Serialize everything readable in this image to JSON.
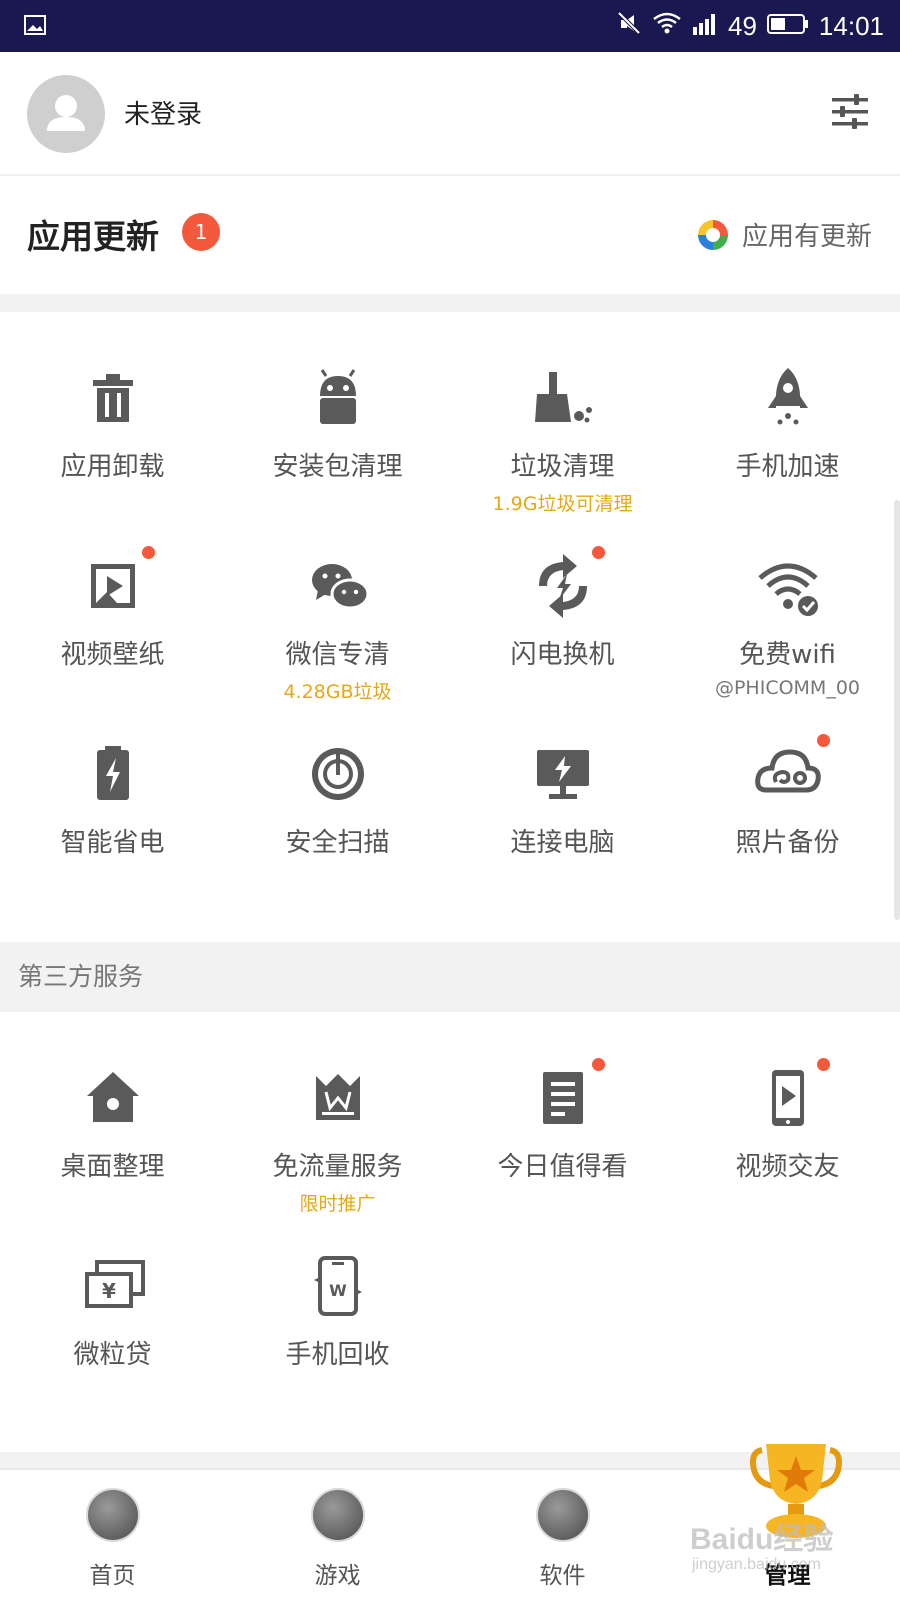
{
  "status_bar": {
    "signal_level": "49",
    "time": "14:01",
    "battery_level": 0.45
  },
  "account": {
    "name": "未登录"
  },
  "updates": {
    "title": "应用更新",
    "badge_count": "1",
    "status_text": "应用有更新"
  },
  "tools": [
    {
      "label": "应用卸载",
      "sub": "",
      "icon": "trash-icon",
      "dot": false
    },
    {
      "label": "安装包清理",
      "sub": "",
      "icon": "android-icon",
      "dot": false
    },
    {
      "label": "垃圾清理",
      "sub": "1.9G垃圾可清理",
      "icon": "broom-icon",
      "dot": false
    },
    {
      "label": "手机加速",
      "sub": "",
      "icon": "rocket-icon",
      "dot": false
    },
    {
      "label": "视频壁纸",
      "sub": "",
      "icon": "video-wallpaper-icon",
      "dot": true
    },
    {
      "label": "微信专清",
      "sub": "4.28GB垃圾",
      "icon": "wechat-icon",
      "dot": false
    },
    {
      "label": "闪电换机",
      "sub": "",
      "icon": "lightning-swap-icon",
      "dot": true
    },
    {
      "label": "免费wifi",
      "sub": "@PHICOMM_00",
      "icon": "wifi-icon",
      "dot": false
    },
    {
      "label": "智能省电",
      "sub": "",
      "icon": "battery-icon",
      "dot": false
    },
    {
      "label": "安全扫描",
      "sub": "",
      "icon": "security-scan-icon",
      "dot": false
    },
    {
      "label": "连接电脑",
      "sub": "",
      "icon": "monitor-icon",
      "dot": false
    },
    {
      "label": "照片备份",
      "sub": "",
      "icon": "cloud-icon",
      "dot": true
    }
  ],
  "third_party": {
    "title": "第三方服务",
    "items": [
      {
        "label": "桌面整理",
        "sub": "",
        "icon": "home-icon",
        "dot": false
      },
      {
        "label": "免流量服务",
        "sub": "限时推广",
        "icon": "crown-icon",
        "dot": false
      },
      {
        "label": "今日值得看",
        "sub": "",
        "icon": "document-icon",
        "dot": true
      },
      {
        "label": "视频交友",
        "sub": "",
        "icon": "video-phone-icon",
        "dot": true
      },
      {
        "label": "微粒贷",
        "sub": "",
        "icon": "yuan-card-icon",
        "dot": false
      },
      {
        "label": "手机回收",
        "sub": "",
        "icon": "phone-recycle-icon",
        "dot": false
      }
    ]
  },
  "bottom_nav": [
    {
      "label": "首页",
      "active": false
    },
    {
      "label": "游戏",
      "active": false
    },
    {
      "label": "软件",
      "active": false
    },
    {
      "label": "管理",
      "active": true
    }
  ],
  "watermark": {
    "text": "Baidu经验",
    "sub": "jingyan.baidu.com"
  },
  "colors": {
    "status_bar_bg": "#1a1850",
    "badge_red": "#f4593c",
    "highlight_yellow": "#e6a817",
    "icon_gray": "#5a5a5a"
  }
}
